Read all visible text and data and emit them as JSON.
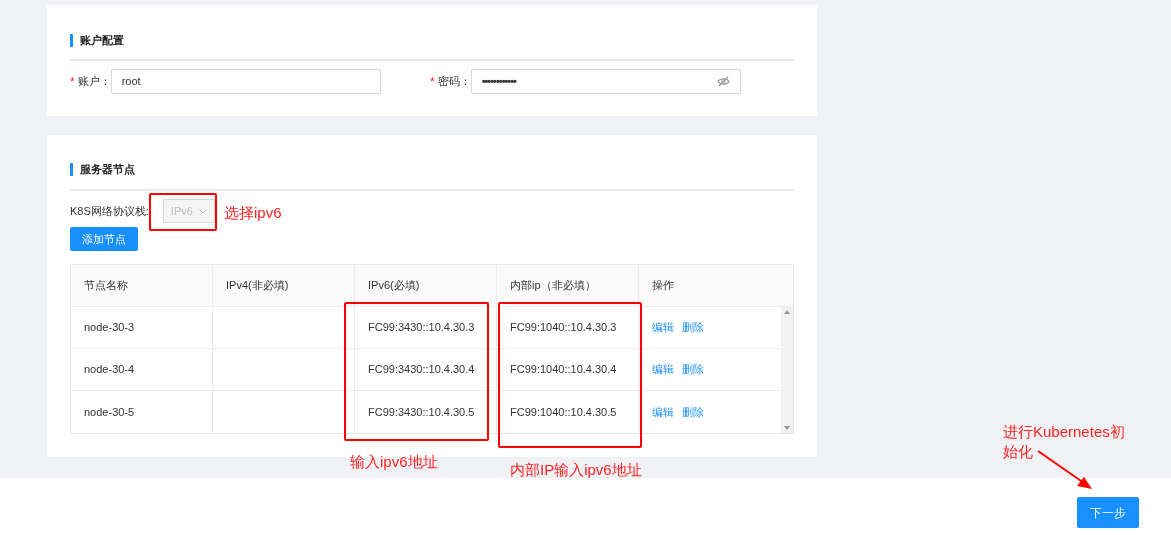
{
  "account_section": {
    "title": "账户配置",
    "fields": [
      {
        "label": "账户：",
        "required_mark": "*",
        "value": "root",
        "kind": "text"
      },
      {
        "label": "密码：",
        "required_mark": "*",
        "value": "••••••••••••",
        "kind": "password"
      }
    ]
  },
  "nodes_section": {
    "title": "服务器节点",
    "protocol": {
      "label": "K8S网络协议栈:",
      "value": "IPv6",
      "disabled": true
    },
    "add_button": "添加节点",
    "table": {
      "columns": [
        "节点名称",
        "IPv4(非必填)",
        "IPv6(必填)",
        "内部ip（非必填）",
        "操作"
      ],
      "rows": [
        {
          "name": "node-30-3",
          "ipv6": "FC99:3430::10.4.30.3",
          "internal": "FC99:1040::10.4.30.3",
          "actions": [
            "编辑",
            "删除"
          ]
        },
        {
          "name": "node-30-4",
          "ipv6": "FC99:3430::10.4.30.4",
          "internal": "FC99:1040::10.4.30.4",
          "actions": [
            "编辑",
            "删除"
          ]
        },
        {
          "name": "node-30-5",
          "ipv6": "FC99:3430::10.4.30.5",
          "internal": "FC99:1040::10.4.30.5",
          "actions": [
            "编辑",
            "删除"
          ]
        }
      ]
    }
  },
  "footer": {
    "next_button": "下一步"
  },
  "annotations": [
    "选择ipv6",
    "输入ipv6地址",
    "内部IP输入ipv6地址",
    "进行Kubernetes初始化"
  ]
}
